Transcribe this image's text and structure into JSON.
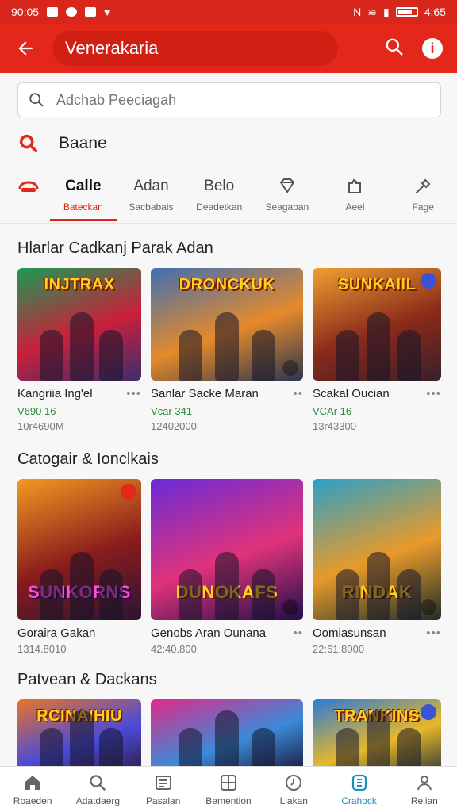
{
  "status": {
    "time": "90:05",
    "battery": "4:65"
  },
  "appbar": {
    "title": "Venerakaria"
  },
  "search": {
    "placeholder": "Adchab Peeciagah"
  },
  "suggestion": {
    "label": "Baane"
  },
  "tabs": [
    {
      "label": "Calle",
      "sub": "Bateckan",
      "icon": "car-icon"
    },
    {
      "label": "Adan",
      "sub": "Sacbabais",
      "icon": ""
    },
    {
      "label": "Belo",
      "sub": "Deadetkan",
      "icon": ""
    },
    {
      "label": "",
      "sub": "Seagaban",
      "icon": "diamond-icon"
    },
    {
      "label": "",
      "sub": "Aeel",
      "icon": "puzzle-icon"
    },
    {
      "label": "",
      "sub": "Fage",
      "icon": "wrench-icon"
    }
  ],
  "sections": [
    {
      "title": "Hlarlar Cadkanj Parak Adan",
      "cards": [
        {
          "name": "Kangriia Ing'el",
          "price": "V690 16",
          "sub": "10r4690M",
          "art": "INJTRAX",
          "colors": [
            "#1a9a55",
            "#c9203a",
            "#3e2c6e"
          ]
        },
        {
          "name": "Sanlar Sacke Maran",
          "price": "Vcar 341",
          "sub": "12402000",
          "art": "DRONCKUK",
          "colors": [
            "#3f6fb3",
            "#e58a2a",
            "#2a3550"
          ]
        },
        {
          "name": "Scakal Oucian",
          "price": "VCAr 16",
          "sub": "13r43300",
          "art": "SUNKAIIL",
          "colors": [
            "#f0a030",
            "#8a2a1a",
            "#3a1f2a"
          ]
        }
      ]
    },
    {
      "title": "Catogair & Ionclkais",
      "cards": [
        {
          "name": "Goraira Gakan",
          "price": "",
          "sub": "1314.8010",
          "art": "SUNKORNS",
          "colors": [
            "#f29a22",
            "#8a1c1c",
            "#2b1333"
          ]
        },
        {
          "name": "Genobs Aran Ounana",
          "price": "",
          "sub": "42:40.800",
          "art": "DUNOKAFS",
          "colors": [
            "#6a2bd8",
            "#e0337a",
            "#1d0f4a"
          ]
        },
        {
          "name": "Oomiasunsan",
          "price": "",
          "sub": "22:61.8000",
          "art": "RINDAK",
          "colors": [
            "#2aa0c8",
            "#e89a2a",
            "#1d2f2a"
          ]
        }
      ]
    },
    {
      "title": "Patvean & Dackans",
      "cards": [
        {
          "name": "",
          "price": "",
          "sub": "",
          "art": "RCINAIHIU",
          "colors": [
            "#e8742a",
            "#4a4ad8",
            "#2a1a3a"
          ]
        },
        {
          "name": "",
          "price": "",
          "sub": "",
          "art": "",
          "colors": [
            "#e02a8a",
            "#3a8ad8",
            "#160a2a"
          ]
        },
        {
          "name": "",
          "price": "",
          "sub": "",
          "art": "TRANKINS",
          "colors": [
            "#2a7ad8",
            "#e8b82a",
            "#1d2a3a"
          ]
        }
      ]
    }
  ],
  "bottom_nav": [
    {
      "label": "Roaeden",
      "icon": "home-icon",
      "active": false
    },
    {
      "label": "Adatdaerg",
      "icon": "search-icon",
      "active": false
    },
    {
      "label": "Pasalan",
      "icon": "list-icon",
      "active": false
    },
    {
      "label": "Bemention",
      "icon": "grid-icon",
      "active": false
    },
    {
      "label": "Llakan",
      "icon": "clock-icon",
      "active": false
    },
    {
      "label": "Crahock",
      "icon": "tag-icon",
      "active": true
    },
    {
      "label": "Relian",
      "icon": "user-icon",
      "active": false
    }
  ],
  "colors": {
    "primary": "#e3271a",
    "accent": "#1a8fb8",
    "price": "#2d8a3e"
  }
}
